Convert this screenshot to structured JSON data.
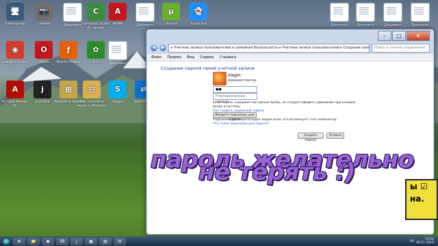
{
  "desktop": {
    "icons": [
      {
        "label": "Компьютер",
        "glyph": "🖥",
        "bg": "#3b5a7a"
      },
      {
        "label": "Снимок",
        "glyph": "📷",
        "bg": "#707070"
      },
      {
        "label": "Документ",
        "glyph": "",
        "bg": ""
      },
      {
        "label": "Camtasia Studio 8 - ярлык",
        "glyph": "C",
        "bg": "#3b8d3c"
      },
      {
        "label": "AVIRA",
        "glyph": "A",
        "bg": "#c8161d"
      },
      {
        "label": "Документ",
        "glyph": "",
        "bg": ""
      },
      {
        "label": "uTorrent",
        "glyph": "µ",
        "bg": "#6bb02e"
      },
      {
        "label": "Snapchat",
        "glyph": "👻",
        "bg": "#1e90ff"
      },
      {
        "label": "Документ",
        "glyph": "",
        "bg": ""
      },
      {
        "label": "Документ",
        "glyph": "",
        "bg": ""
      },
      {
        "label": "Документ",
        "glyph": "",
        "bg": ""
      },
      {
        "label": "Документ",
        "glyph": "",
        "bg": ""
      },
      {
        "label": "Google Chrome",
        "glyph": "◉",
        "bg": "#d33b2c"
      },
      {
        "label": "Opera",
        "glyph": "O",
        "bg": "#c8161d"
      },
      {
        "label": "Mozilla Firefox",
        "glyph": "ƒ",
        "bg": "#e66000"
      },
      {
        "label": "ICQ",
        "glyph": "✿",
        "bg": "#2a8d2a"
      },
      {
        "label": "Документ",
        "glyph": "",
        "bg": ""
      },
      {
        "label": "Acrobat Reader DC",
        "glyph": "A",
        "bg": "#b30b00"
      },
      {
        "label": "InviSible",
        "glyph": "j",
        "bg": "#222"
      },
      {
        "label": "Просмотр видео",
        "glyph": "▦",
        "bg": "#c7a64a"
      },
      {
        "label": "Как показать экран в Windows",
        "glyph": "▤",
        "bg": "#d9b04c"
      },
      {
        "label": "Skype",
        "glyph": "S",
        "bg": "#00aff0"
      },
      {
        "label": "TeamViewer",
        "glyph": "⇄",
        "bg": "#0e6fd1"
      }
    ]
  },
  "window": {
    "address": "▸ Учетные записи пользователей и семейная безопасность ▸ Учетные записи пользователей ▸ Создание своего пароля",
    "search_placeholder": "Поиск в панели управления",
    "menu": [
      "Файл",
      "Правка",
      "Вид",
      "Сервис",
      "Справка"
    ],
    "heading": "Создание пароля своей учетной записи",
    "user_name": "olegm",
    "user_role": "Администратор",
    "password_value": "●●",
    "confirm_placeholder": "Подтверждение пароля",
    "help_text": "Если пароль содержит заглавные буквы, их следует вводить одинаково при каждом входе в систему.",
    "help_link": "Как создать надежный пароль",
    "hint_placeholder": "Введите подсказку для пароля",
    "hint_text": "Подсказка для пароля будет видна всем, кто использует этот компьютер.",
    "hint_link": "Что такое подсказка для пароля?",
    "create_button": "Создать пароль",
    "cancel_button": "Отмена",
    "controls": {
      "min": "–",
      "max": "□",
      "close": "✕"
    }
  },
  "overlay": {
    "line1": "пароль желательно",
    "line2": "не терять :)",
    "sticker_lines": [
      "ы ☑",
      "на."
    ]
  },
  "taskbar": {
    "items": [
      "⊞",
      "📁",
      "◉",
      "🎞",
      "j",
      "▦",
      "▤",
      "W"
    ],
    "tray_time": "13:31",
    "tray_date": "06.11.2016",
    "lang": "RU"
  }
}
